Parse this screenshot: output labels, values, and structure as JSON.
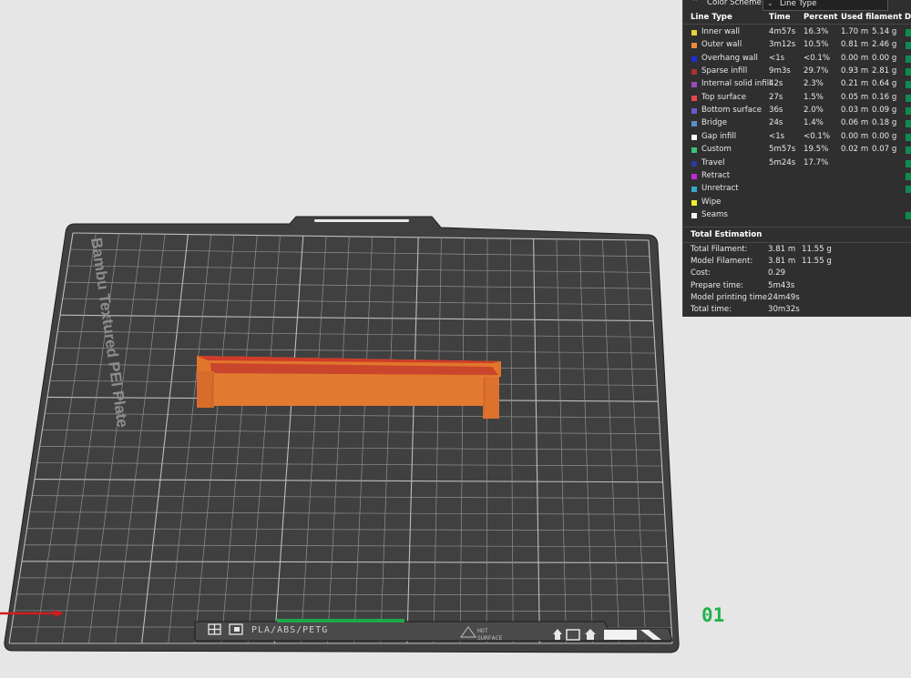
{
  "plate": {
    "name": "Bambu Textured PEI Plate",
    "filament_label": "PLA/ABS/PETG",
    "surface_label": [
      "HOT",
      "SURFACE"
    ],
    "index": "01"
  },
  "legend": {
    "title": "Color Scheme",
    "scheme_value": "Line Type",
    "columns": [
      "Line Type",
      "Time",
      "Percent",
      "Used filament",
      "Di"
    ],
    "rows": [
      {
        "name": "Inner wall",
        "time": "4m57s",
        "percent": "16.3%",
        "length": "1.70 m",
        "weight": "5.14 g",
        "color": "#e8d33a",
        "checked": true
      },
      {
        "name": "Outer wall",
        "time": "3m12s",
        "percent": "10.5%",
        "length": "0.81 m",
        "weight": "2.46 g",
        "color": "#f08a3a",
        "checked": true
      },
      {
        "name": "Overhang wall",
        "time": "<1s",
        "percent": "<0.1%",
        "length": "0.00 m",
        "weight": "0.00 g",
        "color": "#1a2fd6",
        "checked": true
      },
      {
        "name": "Sparse infill",
        "time": "9m3s",
        "percent": "29.7%",
        "length": "0.93 m",
        "weight": "2.81 g",
        "color": "#a83232",
        "checked": true
      },
      {
        "name": "Internal solid infill",
        "time": "42s",
        "percent": "2.3%",
        "length": "0.21 m",
        "weight": "0.64 g",
        "color": "#9b4bb8",
        "checked": true
      },
      {
        "name": "Top surface",
        "time": "27s",
        "percent": "1.5%",
        "length": "0.05 m",
        "weight": "0.16 g",
        "color": "#e84646",
        "checked": true
      },
      {
        "name": "Bottom surface",
        "time": "36s",
        "percent": "2.0%",
        "length": "0.03 m",
        "weight": "0.09 g",
        "color": "#6a5acd",
        "checked": true
      },
      {
        "name": "Bridge",
        "time": "24s",
        "percent": "1.4%",
        "length": "0.06 m",
        "weight": "0.18 g",
        "color": "#5b8fc7",
        "checked": true
      },
      {
        "name": "Gap infill",
        "time": "<1s",
        "percent": "<0.1%",
        "length": "0.00 m",
        "weight": "0.00 g",
        "color": "#ffffff",
        "checked": true
      },
      {
        "name": "Custom",
        "time": "5m57s",
        "percent": "19.5%",
        "length": "0.02 m",
        "weight": "0.07 g",
        "color": "#3fc27a",
        "checked": true
      },
      {
        "name": "Travel",
        "time": "5m24s",
        "percent": "17.7%",
        "length": "",
        "weight": "",
        "color": "#2a3b9c",
        "checked": true
      },
      {
        "name": "Retract",
        "time": "",
        "percent": "",
        "length": "",
        "weight": "",
        "color": "#c02ad0",
        "checked": true
      },
      {
        "name": "Unretract",
        "time": "",
        "percent": "",
        "length": "",
        "weight": "",
        "color": "#3aa6c9",
        "checked": true
      },
      {
        "name": "Wipe",
        "time": "",
        "percent": "",
        "length": "",
        "weight": "",
        "color": "#f0f02a",
        "checked": false
      },
      {
        "name": "Seams",
        "time": "",
        "percent": "",
        "length": "",
        "weight": "",
        "color": "#f2f2f2",
        "checked": true
      }
    ],
    "total_title": "Total Estimation",
    "totals": [
      {
        "label": "Total Filament:",
        "v1": "3.81 m",
        "v2": "11.55 g"
      },
      {
        "label": "Model Filament:",
        "v1": "3.81 m",
        "v2": "11.55 g"
      },
      {
        "label": "Cost:",
        "v1": "0.29",
        "v2": ""
      },
      {
        "label": "Prepare time:",
        "v1": "5m43s",
        "v2": ""
      },
      {
        "label": "Model printing time:",
        "v1": "24m49s",
        "v2": ""
      },
      {
        "label": "Total time:",
        "v1": "30m32s",
        "v2": ""
      }
    ]
  },
  "colors": {
    "background": "#e6e6e6",
    "plate": "#404040",
    "grid": "#9a9a9a",
    "model": "#e0762b",
    "model_top": "#cf3b2b",
    "accent": "#22b24c"
  },
  "icons": [
    "plate-settings-icon",
    "plate-copy-icon",
    "arrange-icon",
    "orient-icon",
    "lock-icon"
  ]
}
